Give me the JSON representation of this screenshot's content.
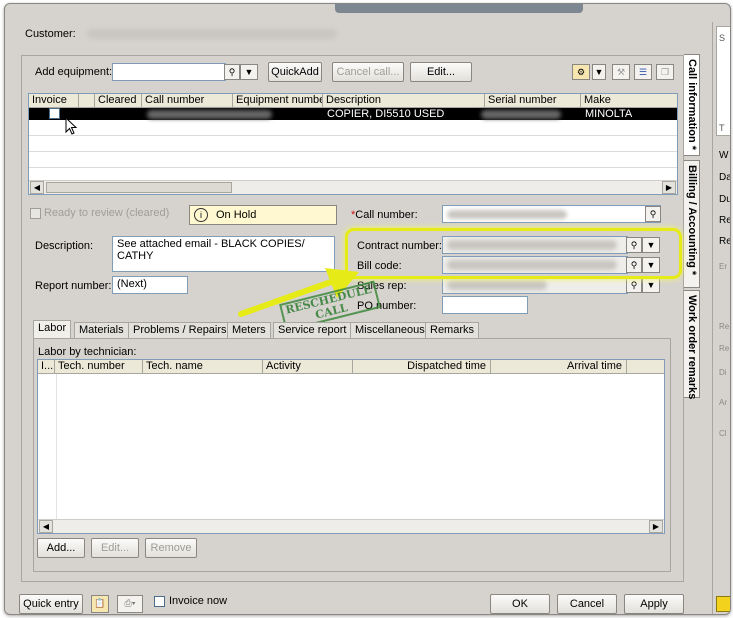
{
  "header": {
    "customer_label": "Customer:"
  },
  "equipment": {
    "add_label": "Add equipment:",
    "quickadd": "QuickAdd",
    "cancel_call": "Cancel call...",
    "edit": "Edit...",
    "columns": [
      "Invoice",
      "Cleared",
      "Call number",
      "Equipment number",
      "Description",
      "Serial number",
      "Make"
    ],
    "row": {
      "description": "COPIER, DI5510 USED",
      "make": "MINOLTA"
    }
  },
  "status": {
    "ready_to_review": "Ready to review (cleared)",
    "on_hold": "On Hold",
    "call_number_label": "Call number:",
    "required_marker": "*"
  },
  "details": {
    "description_label": "Description:",
    "description_value": "See attached email  - BLACK COPIES/ CATHY",
    "report_number_label": "Report number:",
    "report_number_value": "(Next)",
    "contract_number_label": "Contract number:",
    "bill_code_label": "Bill code:",
    "sales_rep_label": "Sales rep:",
    "po_number_label": "PO number:"
  },
  "annotation": {
    "stamp_line1": "RESCHEDULE",
    "stamp_line2": "CALL"
  },
  "tabs": [
    "Labor",
    "Materials",
    "Problems / Repairs",
    "Meters",
    "Service report",
    "Miscellaneous",
    "Remarks"
  ],
  "labor": {
    "group_label": "Labor by technician:",
    "columns": [
      "I...",
      "Tech. number",
      "Tech. name",
      "Activity",
      "Dispatched time",
      "Arrival time"
    ],
    "add": "Add...",
    "edit": "Edit...",
    "remove": "Remove"
  },
  "side_tabs": [
    "Call information *",
    "Billing / Accounting *",
    "Work order remarks"
  ],
  "footer": {
    "quick_entry": "Quick entry",
    "invoice_now": "Invoice now",
    "ok": "OK",
    "cancel": "Cancel",
    "apply": "Apply"
  },
  "right_panel_letters": [
    "W",
    "Da",
    "Du",
    "Re",
    "Re",
    "Er",
    "Re",
    "Re",
    "Di",
    "Ar",
    "Cl",
    "T",
    "S"
  ],
  "colors": {
    "selected_row": "#000000",
    "highlight": "#e6ea16",
    "stamp": "#2e7d32",
    "required": "#d01010"
  }
}
